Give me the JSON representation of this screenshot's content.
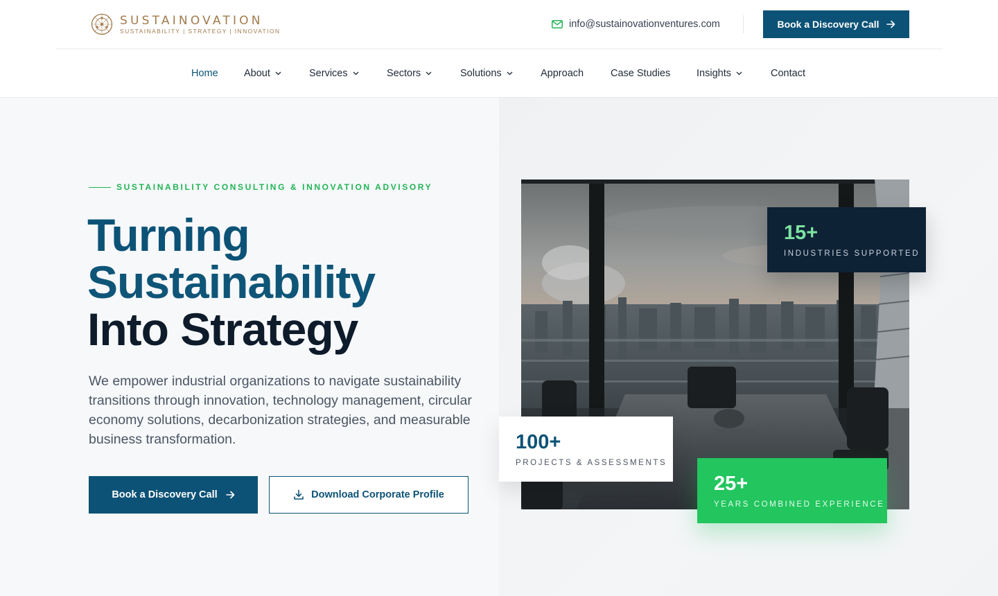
{
  "brand": {
    "name": "SUSTAINOVATION",
    "tagline": "SUSTAINABILITY | STRATEGY | INNOVATION",
    "color": "#a17a4c"
  },
  "header": {
    "email": "info@sustainovationventures.com",
    "cta_label": "Book a Discovery Call"
  },
  "nav": {
    "items": [
      {
        "label": "Home",
        "active": true,
        "dropdown": false
      },
      {
        "label": "About",
        "active": false,
        "dropdown": true
      },
      {
        "label": "Services",
        "active": false,
        "dropdown": true
      },
      {
        "label": "Sectors",
        "active": false,
        "dropdown": true
      },
      {
        "label": "Solutions",
        "active": false,
        "dropdown": true
      },
      {
        "label": "Approach",
        "active": false,
        "dropdown": false
      },
      {
        "label": "Case Studies",
        "active": false,
        "dropdown": false
      },
      {
        "label": "Insights",
        "active": false,
        "dropdown": true
      },
      {
        "label": "Contact",
        "active": false,
        "dropdown": false
      }
    ]
  },
  "hero": {
    "eyebrow": "SUSTAINABILITY CONSULTING & INNOVATION ADVISORY",
    "headline": [
      "Turning",
      "Sustainability",
      "Into Strategy"
    ],
    "lead": "We empower industrial organizations to navigate sustainability transitions through innovation, technology management, circular economy solutions, decarbonization strategies, and measurable business transformation.",
    "primary_cta": "Book a Discovery Call",
    "secondary_cta": "Download Corporate Profile"
  },
  "stats": [
    {
      "value": "15+",
      "label": "INDUSTRIES SUPPORTED"
    },
    {
      "value": "100+",
      "label": "PROJECTS & ASSESSMENTS"
    },
    {
      "value": "25+",
      "label": "YEARS COMBINED EXPERIENCE"
    }
  ],
  "colors": {
    "primary": "#0c5276",
    "accent": "#22c55e",
    "dark": "#0e2236",
    "gold": "#a17a4c"
  },
  "icons": [
    "logo-mark-icon",
    "mail-icon",
    "arrow-right-icon",
    "chevron-down-icon",
    "download-icon"
  ]
}
